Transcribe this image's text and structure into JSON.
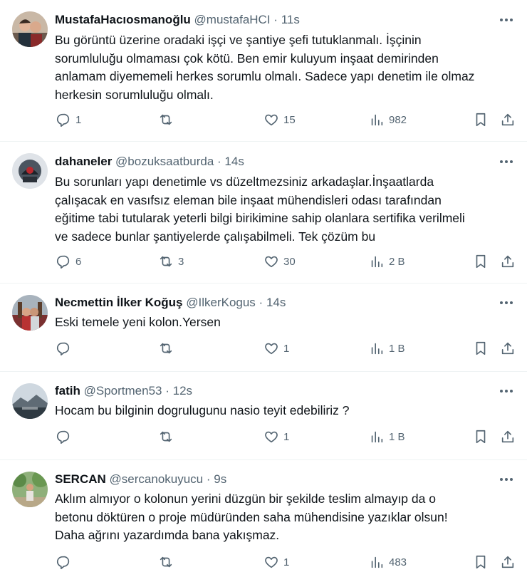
{
  "tweets": [
    {
      "name": "MustafaHacıosmanoğlu",
      "handle": "@mustafaHCI",
      "time": "11s",
      "lines": [
        "Bu görüntü üzerine oradaki işçi ve şantiye şefi tutuklanmalı. İşçinin",
        "sorumluluğu olmaması çok kötü. Ben emir kuluyum inşaat demirinden",
        "anlamam diyememeli herkes sorumlu olmalı. Sadece yapı denetim ile olmaz",
        "herkesin sorumluluğu olmalı."
      ],
      "replies": "1",
      "retweets": "",
      "likes": "15",
      "views": "982"
    },
    {
      "name": "dahaneler",
      "handle": "@bozuksaatburda",
      "time": "14s",
      "lines": [
        "Bu sorunları yapı denetimle vs düzeltmezsiniz arkadaşlar.İnşaatlarda",
        "çalışacak en vasıfsız eleman bile inşaat mühendisleri odası tarafından",
        "eğitime tabi tutularak yeterli bilgi birikimine sahip olanlara sertifika verilmeli",
        "ve sadece bunlar şantiyelerde çalışabilmeli. Tek çözüm bu"
      ],
      "replies": "6",
      "retweets": "3",
      "likes": "30",
      "views": "2 B"
    },
    {
      "name": "Necmettin İlker Koğuş",
      "handle": "@IlkerKogus",
      "time": "14s",
      "lines": [
        "Eski temele yeni kolon.Yersen"
      ],
      "replies": "",
      "retweets": "",
      "likes": "1",
      "views": "1 B"
    },
    {
      "name": "fatih",
      "handle": "@Sportmen53",
      "time": "12s",
      "lines": [
        "Hocam bu bilginin dogrulugunu nasio teyit edebiliriz ?"
      ],
      "replies": "",
      "retweets": "",
      "likes": "1",
      "views": "1 B"
    },
    {
      "name": "SERCAN",
      "handle": "@sercanokuyucu",
      "time": "9s",
      "lines": [
        "Aklım almıyor o kolonun yerini düzgün bir şekilde teslim almayıp da o",
        "betonu döktüren o proje müdüründen saha mühendisine yazıklar olsun!",
        "Daha ağrını yazardımda bana yakışmaz."
      ],
      "replies": "",
      "retweets": "",
      "likes": "1",
      "views": "483"
    }
  ],
  "icons": {
    "more": "more-icon",
    "reply": "reply-icon",
    "retweet": "retweet-icon",
    "like": "heart-icon",
    "views": "views-icon",
    "bookmark": "bookmark-icon",
    "share": "share-icon"
  },
  "colors": {
    "text": "#0f1419",
    "secondary": "#536471",
    "divider": "#eff3f4"
  },
  "separator": "·"
}
